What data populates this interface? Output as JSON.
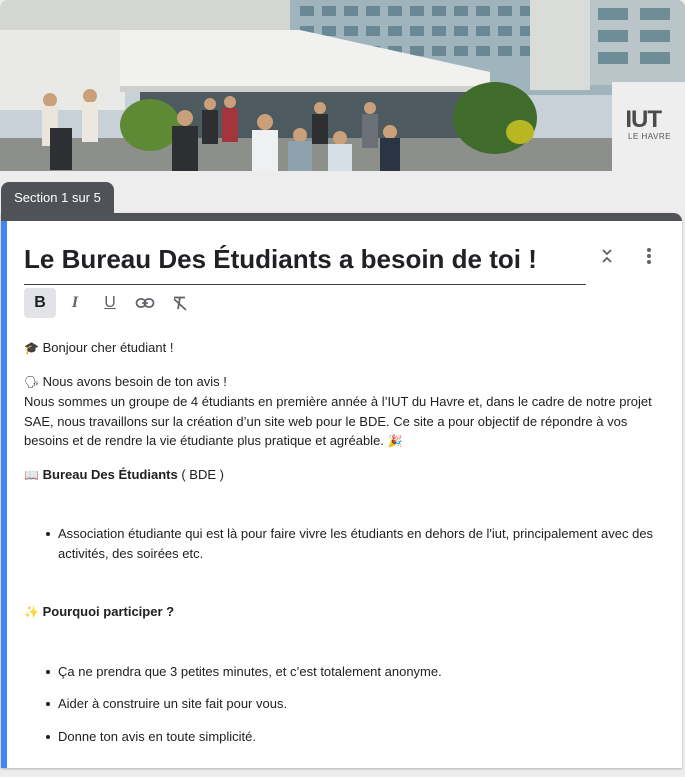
{
  "header": {
    "image_alt": "Photo de l'IUT du Havre",
    "logo_text": "IUT",
    "logo_subtext": "LE HAVRE"
  },
  "section_tab": {
    "label": "Section 1 sur 5"
  },
  "card": {
    "title": "Le Bureau Des Étudiants a besoin de toi !",
    "collapse_icon": "collapse-icon",
    "more_icon": "more-vert-icon"
  },
  "toolbar": {
    "bold": "B",
    "italic": "I",
    "underline": "U",
    "link_icon": "link-icon",
    "clear_format_icon": "clear-format-icon"
  },
  "description": {
    "greeting_emoji": "🎓",
    "greeting": "Bonjour cher étudiant !",
    "avis_emoji": "🗣",
    "avis_line": "Nous avons besoin de ton avis !",
    "intro": "Nous sommes un groupe de 4 étudiants en première année à l’IUT du Havre et, dans le cadre de notre projet SAE, nous travaillons sur la création d’un site web pour le BDE. Ce site a pour objectif de répondre à vos besoins et de rendre la vie étudiante plus pratique et agréable.",
    "intro_emoji": "🎉",
    "bde_emoji": "📖",
    "bde_title": "Bureau Des Étudiants",
    "bde_suffix": " ( BDE )",
    "bde_items": [
      "Association étudiante qui est là pour faire vivre les étudiants en dehors de l'iut, principalement avec des activités, des soirées etc."
    ],
    "why_emoji": "✨",
    "why_title": "Pourquoi participer ?",
    "why_items": [
      "Ça ne prendra que 3 petites minutes, et c’est totalement anonyme.",
      "Aider à construire un site fait pour vous.",
      "Donne ton avis en toute simplicité."
    ]
  },
  "colors": {
    "accent_bar": "#4285f4",
    "tab_bg": "#4f5358",
    "page_bg": "#ededed"
  }
}
